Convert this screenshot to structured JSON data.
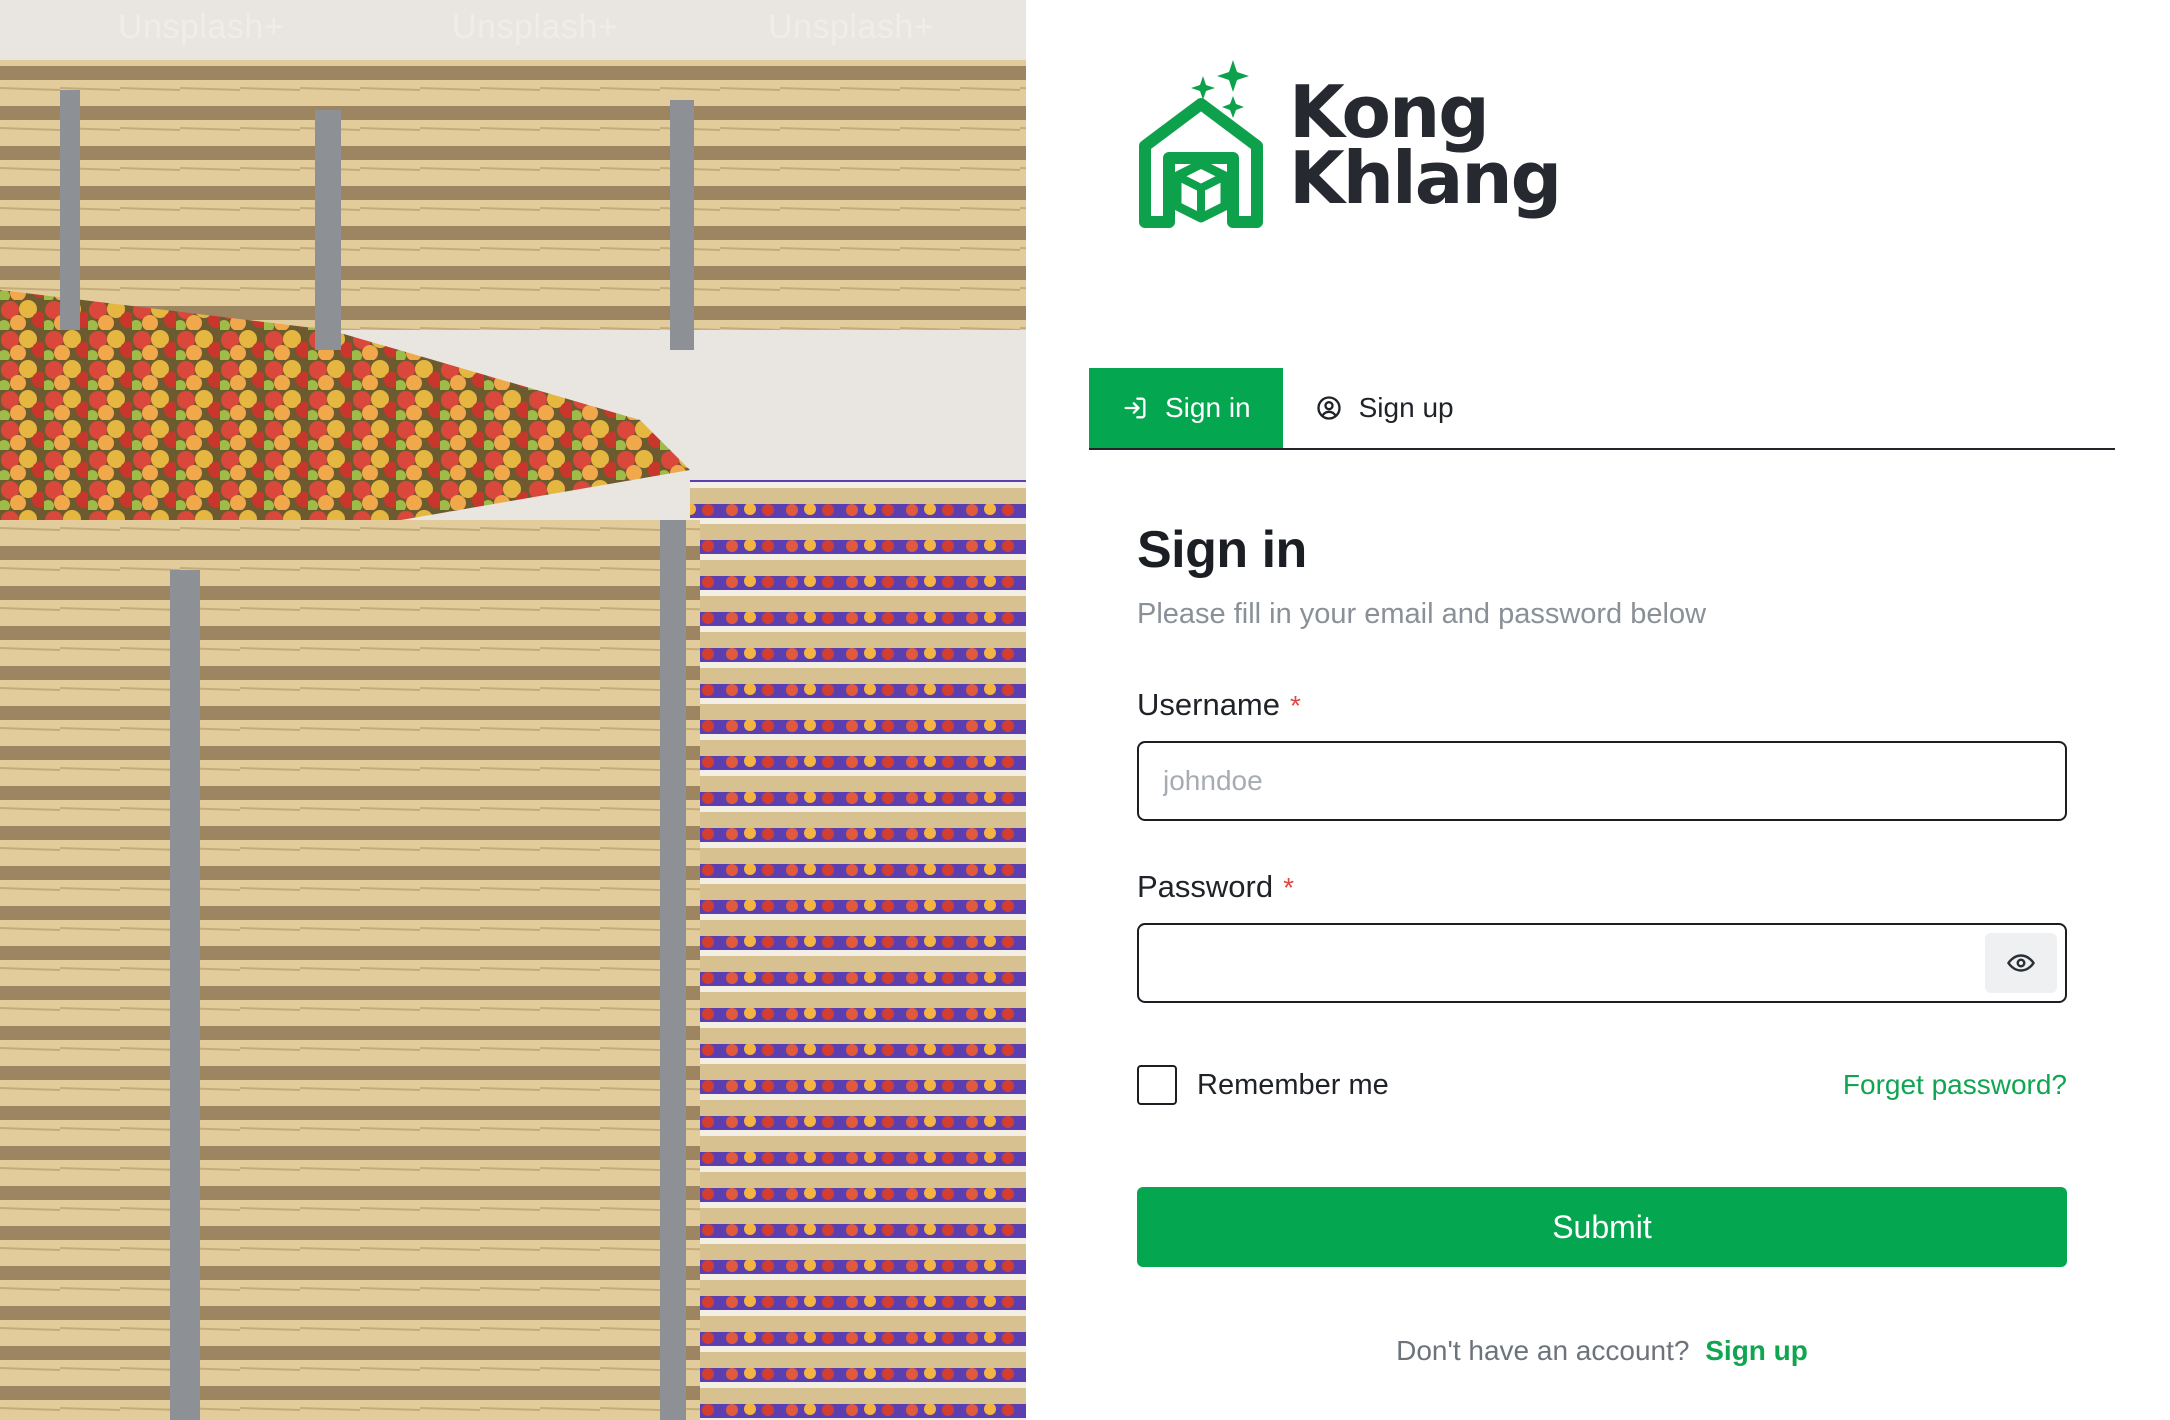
{
  "photo": {
    "watermark_text": "Unsplash+",
    "alt": "Apple crates in storage"
  },
  "brand": {
    "name_line1": "Kong",
    "name_line2": "Khlang",
    "color": "#0ea14b"
  },
  "tabs": [
    {
      "label": "Sign in",
      "icon": "sign-in-icon",
      "active": true
    },
    {
      "label": "Sign up",
      "icon": "user-circle-icon",
      "active": false
    }
  ],
  "form": {
    "title": "Sign in",
    "subtitle": "Please fill in your email and password below",
    "username": {
      "label": "Username",
      "required_mark": "*",
      "placeholder": "johndoe",
      "value": ""
    },
    "password": {
      "label": "Password",
      "required_mark": "*",
      "placeholder": "",
      "value": "",
      "toggle_icon": "eye-icon"
    },
    "remember_label": "Remember me",
    "remember_checked": false,
    "forgot_label": "Forget password?",
    "submit_label": "Submit",
    "footer_prompt": "Don't have an account?",
    "footer_link": "Sign up"
  },
  "colors": {
    "accent": "#05a650",
    "text": "#1f2328",
    "muted": "#8a9097",
    "required": "#e0473f"
  }
}
